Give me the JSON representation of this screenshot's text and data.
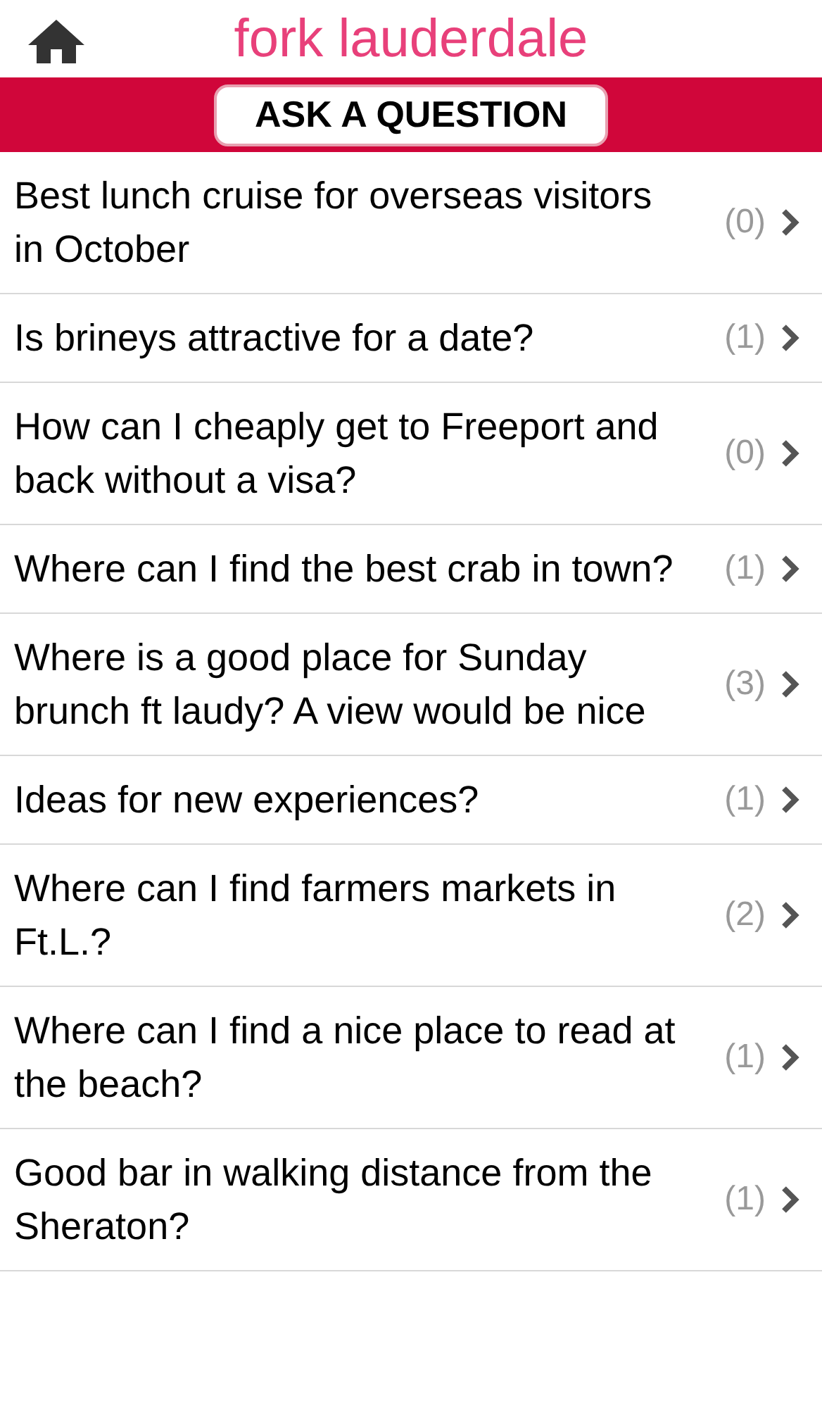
{
  "header": {
    "title": "fork lauderdale"
  },
  "ask_button": {
    "label": "ASK A QUESTION"
  },
  "questions": [
    {
      "title": "Best lunch cruise for overseas visitors in October",
      "count": "(0)"
    },
    {
      "title": "Is brineys attractive for a date?",
      "count": "(1)"
    },
    {
      "title": "How can I cheaply get to Freeport and back without a visa?",
      "count": "(0)"
    },
    {
      "title": "Where can I find the best crab in town?",
      "count": "(1)"
    },
    {
      "title": "Where is a good place for Sunday brunch ft laudy? A view would be nice",
      "count": "(3)"
    },
    {
      "title": "Ideas for new experiences?",
      "count": "(1)"
    },
    {
      "title": "Where can I find farmers markets in Ft.L.?",
      "count": "(2)"
    },
    {
      "title": "Where can I find a nice place to read at the beach?",
      "count": "(1)"
    },
    {
      "title": "Good bar in walking distance from the Sheraton?",
      "count": "(1)"
    }
  ]
}
